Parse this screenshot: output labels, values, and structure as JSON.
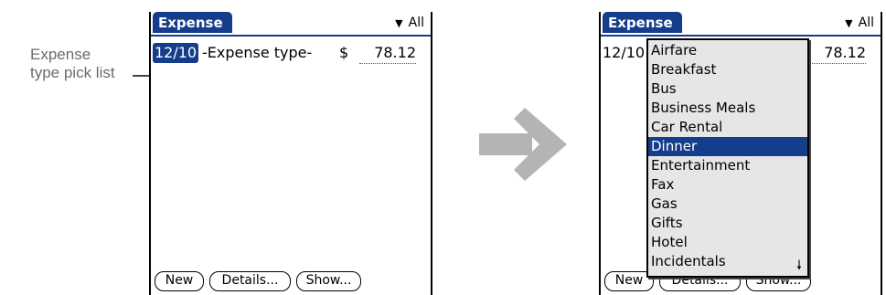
{
  "callout": {
    "line1": "Expense",
    "line2": "type pick list"
  },
  "left_screen": {
    "app_title": "Expense",
    "category_filter": "All",
    "row": {
      "date": "12/10",
      "expense_type": "-Expense type-",
      "currency": "$",
      "amount": "78.12"
    },
    "buttons": {
      "new": "New",
      "details": "Details...",
      "show": "Show..."
    }
  },
  "right_screen": {
    "app_title": "Expense",
    "category_filter": "All",
    "row": {
      "date": "12/10",
      "amount": "78.12"
    },
    "buttons": {
      "new": "New",
      "details": "Details...",
      "show": "Show..."
    },
    "pick_list": {
      "items": [
        "Airfare",
        "Breakfast",
        "Bus",
        "Business Meals",
        "Car Rental",
        "Dinner",
        "Entertainment",
        "Fax",
        "Gas",
        "Gifts",
        "Hotel",
        "Incidentals"
      ],
      "selected": "Dinner"
    }
  },
  "icons": {
    "category_arrow": "dropdown-triangle-icon",
    "transition_arrow": "right-arrow-icon",
    "scroll": "scroll-down-arrow-icon"
  },
  "colors": {
    "accent": "#143e8c",
    "callout_text": "#6b6b6b",
    "transition_arrow": "#b4b4b4",
    "popup_bg": "#e6e6e6"
  }
}
